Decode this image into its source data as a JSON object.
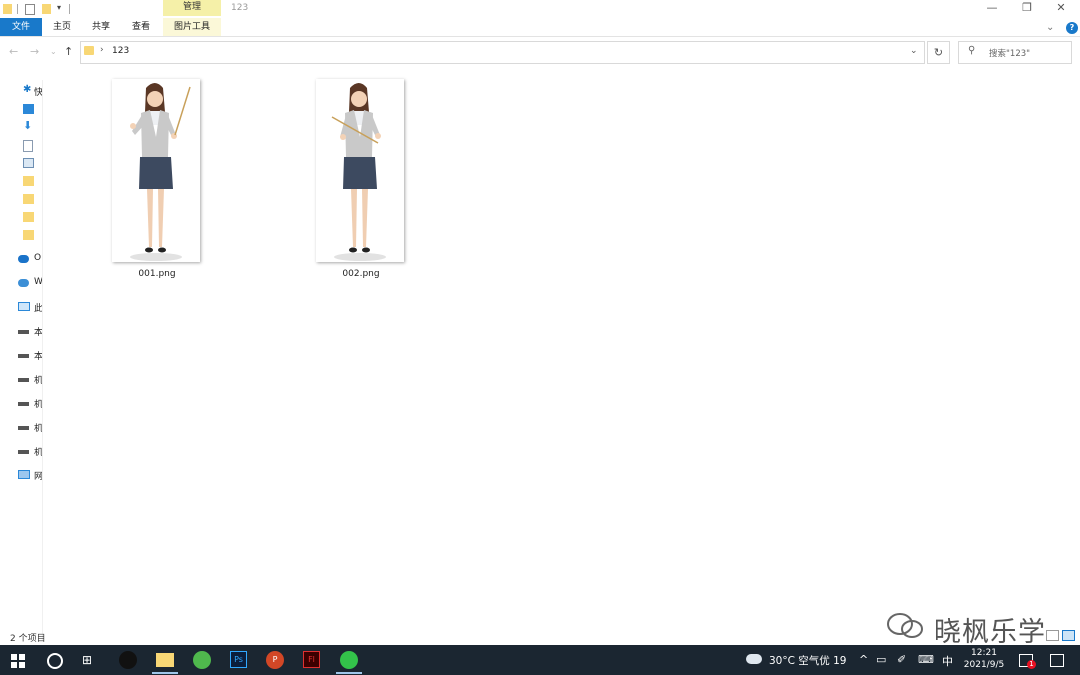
{
  "window": {
    "title": "123",
    "manage_tab": "管理",
    "minimize": "—",
    "maximize": "❐",
    "close": "✕"
  },
  "ribbon": {
    "tabs": [
      "文件",
      "主页",
      "共享",
      "查看",
      "图片工具"
    ],
    "help": "?"
  },
  "address": {
    "path": "123",
    "search_placeholder": "搜索\"123\""
  },
  "nav_pane": {
    "items": [
      "快",
      "",
      "",
      "",
      "",
      "",
      "",
      "",
      "O",
      "W",
      "此",
      "本",
      "本",
      "机",
      "机",
      "机",
      "机",
      "网"
    ]
  },
  "files": [
    {
      "name": "001.png"
    },
    {
      "name": "002.png"
    }
  ],
  "status": {
    "item_count": "2 个项目"
  },
  "watermark": "晓枫乐学",
  "taskbar": {
    "weather": "30°C 空气优 19",
    "ime": "中",
    "time": "12:21",
    "date": "2021/9/5",
    "notification_count": "1"
  },
  "colors": {
    "accent": "#1979ca",
    "taskbar": "#1b2631",
    "folder": "#f8d775",
    "manage_tab": "#f5f0a8"
  }
}
